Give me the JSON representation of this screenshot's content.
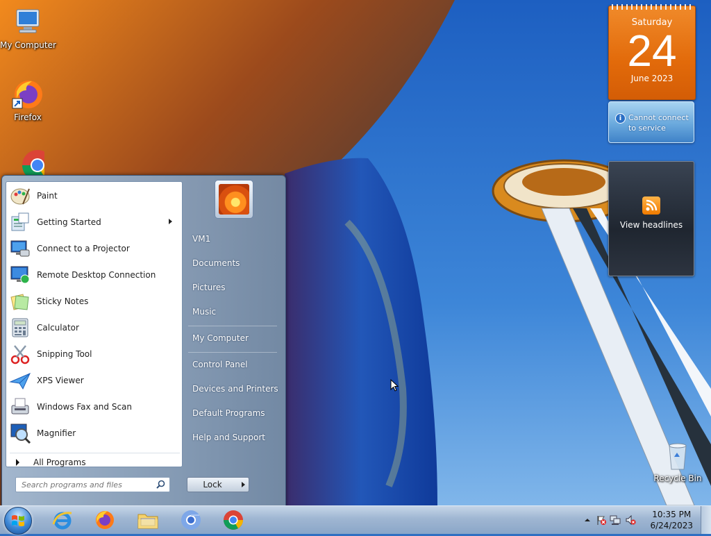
{
  "desktop": {
    "icons": [
      {
        "label": "My Computer",
        "icon": "computer-icon"
      },
      {
        "label": "Firefox",
        "icon": "firefox-icon"
      },
      {
        "label": "",
        "icon": "chrome-icon"
      },
      {
        "label": "Recycle Bin",
        "icon": "recycle-bin-icon"
      }
    ]
  },
  "gadgets": {
    "calendar": {
      "day_name": "Saturday",
      "day_number": "24",
      "month_year": "June 2023"
    },
    "weather": {
      "message_line1": "Cannot connect",
      "message_line2": "to service"
    },
    "headlines": {
      "label": "View headlines"
    }
  },
  "start_menu": {
    "programs": [
      {
        "label": "Paint",
        "icon": "paint-icon",
        "has_submenu": false
      },
      {
        "label": "Getting Started",
        "icon": "getting-started-icon",
        "has_submenu": true
      },
      {
        "label": "Connect to a Projector",
        "icon": "projector-icon",
        "has_submenu": false
      },
      {
        "label": "Remote Desktop Connection",
        "icon": "remote-desktop-icon",
        "has_submenu": false
      },
      {
        "label": "Sticky Notes",
        "icon": "sticky-notes-icon",
        "has_submenu": false
      },
      {
        "label": "Calculator",
        "icon": "calculator-icon",
        "has_submenu": false
      },
      {
        "label": "Snipping Tool",
        "icon": "snipping-tool-icon",
        "has_submenu": false
      },
      {
        "label": "XPS Viewer",
        "icon": "xps-viewer-icon",
        "has_submenu": false
      },
      {
        "label": "Windows Fax and Scan",
        "icon": "fax-scan-icon",
        "has_submenu": false
      },
      {
        "label": "Magnifier",
        "icon": "magnifier-icon",
        "has_submenu": false
      }
    ],
    "all_programs_label": "All Programs",
    "search_placeholder": "Search programs and files",
    "places": [
      {
        "label": "VM1"
      },
      {
        "label": "Documents"
      },
      {
        "label": "Pictures"
      },
      {
        "label": "Music"
      },
      {
        "label": "My Computer"
      },
      {
        "label": "Control Panel"
      },
      {
        "label": "Devices and Printers"
      },
      {
        "label": "Default Programs"
      },
      {
        "label": "Help and Support"
      }
    ],
    "lock_label": "Lock"
  },
  "taskbar": {
    "pinned": [
      {
        "name": "internet-explorer",
        "icon": "internet-explorer-icon"
      },
      {
        "name": "firefox",
        "icon": "firefox-icon"
      },
      {
        "name": "file-explorer",
        "icon": "folder-icon"
      },
      {
        "name": "chromium",
        "icon": "chromium-icon"
      },
      {
        "name": "chrome",
        "icon": "chrome-icon"
      }
    ],
    "clock": {
      "time": "10:35 PM",
      "date": "6/24/2023"
    }
  },
  "colors": {
    "calendar_orange": "#e26a0a",
    "start_menu_glass": "#9fb6d2",
    "sky_blue": "#2f6fc2"
  }
}
